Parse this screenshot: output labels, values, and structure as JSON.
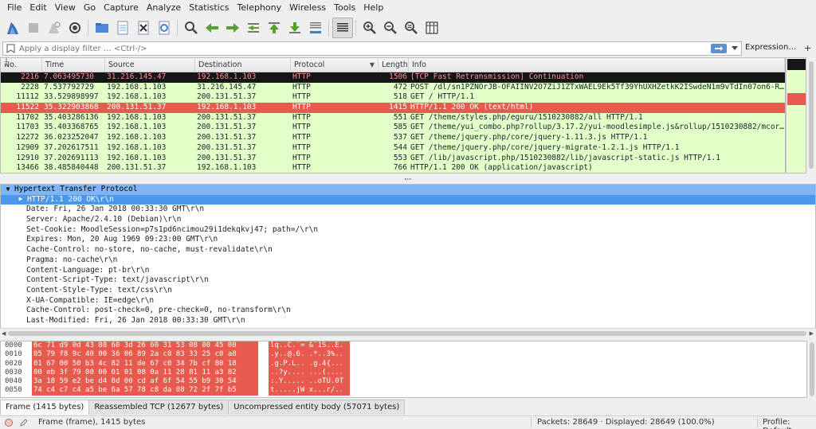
{
  "menu": [
    "File",
    "Edit",
    "View",
    "Go",
    "Capture",
    "Analyze",
    "Statistics",
    "Telephony",
    "Wireless",
    "Tools",
    "Help"
  ],
  "toolbar_icons": [
    "shark-fin-icon",
    "stop-icon",
    "restart-icon",
    "options-gear-icon",
    "open-folder-icon",
    "save-file-icon",
    "close-file-icon",
    "reload-icon",
    "find-icon",
    "back-arrow-icon",
    "forward-arrow-icon",
    "go-to-packet-icon",
    "first-packet-icon",
    "last-packet-icon",
    "auto-scroll-icon",
    "colorize-icon",
    "zoom-in-icon",
    "zoom-out-icon",
    "zoom-normal-icon",
    "resize-columns-icon"
  ],
  "filter": {
    "placeholder": "Apply a display filter … <Ctrl-/>",
    "expression_label": "Expression…",
    "plus_label": "+"
  },
  "packet_list": {
    "columns": [
      "No.",
      "Time",
      "Source",
      "Destination",
      "Protocol",
      "Length",
      "Info"
    ],
    "rows": [
      {
        "no": "2216",
        "time": "7.063495730",
        "src": "31.216.145.47",
        "dst": "192.168.1.103",
        "proto": "HTTP",
        "len": "1506",
        "info": "[TCP Fast Retransmission] Continuation",
        "style": "black",
        "marker": ""
      },
      {
        "no": "2228",
        "time": "7.537792729",
        "src": "192.168.1.103",
        "dst": "31.216.145.47",
        "proto": "HTTP",
        "len": "472",
        "info": "POST /dl/sn1PZNOrJB-OFAIINV2O7ZiJ1ZTxWAEL9Ek5Tf39YhUXHZetkK2ISwdeN1m9vTdIn07on6-R…",
        "style": "green",
        "marker": ""
      },
      {
        "no": "11112",
        "time": "33.529898997",
        "src": "192.168.1.103",
        "dst": "200.131.51.37",
        "proto": "HTTP",
        "len": "518",
        "info": "GET / HTTP/1.1",
        "style": "green",
        "marker": "┼"
      },
      {
        "no": "11522",
        "time": "35.322903868",
        "src": "200.131.51.37",
        "dst": "192.168.1.103",
        "proto": "HTTP",
        "len": "1415",
        "info": "HTTP/1.1 200 OK  (text/html)",
        "style": "red",
        "marker": "←"
      },
      {
        "no": "11702",
        "time": "35.403286136",
        "src": "192.168.1.103",
        "dst": "200.131.51.37",
        "proto": "HTTP",
        "len": "551",
        "info": "GET /theme/styles.php/eguru/1510230882/all HTTP/1.1",
        "style": "green",
        "marker": "│"
      },
      {
        "no": "11703",
        "time": "35.403368765",
        "src": "192.168.1.103",
        "dst": "200.131.51.37",
        "proto": "HTTP",
        "len": "585",
        "info": "GET /theme/yui_combo.php?rollup/3.17.2/yui-moodlesimple.js&rollup/1510230882/mcor…",
        "style": "green",
        "marker": "│"
      },
      {
        "no": "12272",
        "time": "36.023252047",
        "src": "192.168.1.103",
        "dst": "200.131.51.37",
        "proto": "HTTP",
        "len": "537",
        "info": "GET /theme/jquery.php/core/jquery-1.11.3.js HTTP/1.1",
        "style": "green",
        "marker": "│"
      },
      {
        "no": "12909",
        "time": "37.202617511",
        "src": "192.168.1.103",
        "dst": "200.131.51.37",
        "proto": "HTTP",
        "len": "544",
        "info": "GET /theme/jquery.php/core/jquery-migrate-1.2.1.js HTTP/1.1",
        "style": "green",
        "marker": "│"
      },
      {
        "no": "12910",
        "time": "37.202691113",
        "src": "192.168.1.103",
        "dst": "200.131.51.37",
        "proto": "HTTP",
        "len": "553",
        "info": "GET /lib/javascript.php/1510230882/lib/javascript-static.js HTTP/1.1",
        "style": "green",
        "marker": "│"
      },
      {
        "no": "13466",
        "time": "38.485840448",
        "src": "200.131.51.37",
        "dst": "192.168.1.103",
        "proto": "HTTP",
        "len": "766",
        "info": "HTTP/1.1 200 OK  (application/javascript)",
        "style": "green",
        "marker": "│"
      }
    ]
  },
  "details": [
    {
      "text": "Hypertext Transfer Protocol",
      "indent": 0,
      "tri": "▼",
      "style": "sel"
    },
    {
      "text": "HTTP/1.1 200 OK\\r\\n",
      "indent": 1,
      "tri": "▶",
      "style": "sel2"
    },
    {
      "text": "Date: Fri, 26 Jan 2018 00:33:30 GMT\\r\\n",
      "indent": 2,
      "tri": "",
      "style": ""
    },
    {
      "text": "Server: Apache/2.4.10 (Debian)\\r\\n",
      "indent": 2,
      "tri": "",
      "style": ""
    },
    {
      "text": "Set-Cookie: MoodleSession=p7s1pd6ncimou29i1dekqkvj47; path=/\\r\\n",
      "indent": 2,
      "tri": "",
      "style": ""
    },
    {
      "text": "Expires: Mon, 20 Aug 1969 09:23:00 GMT\\r\\n",
      "indent": 2,
      "tri": "",
      "style": ""
    },
    {
      "text": "Cache-Control: no-store, no-cache, must-revalidate\\r\\n",
      "indent": 2,
      "tri": "",
      "style": ""
    },
    {
      "text": "Pragma: no-cache\\r\\n",
      "indent": 2,
      "tri": "",
      "style": ""
    },
    {
      "text": "Content-Language: pt-br\\r\\n",
      "indent": 2,
      "tri": "",
      "style": ""
    },
    {
      "text": "Content-Script-Type: text/javascript\\r\\n",
      "indent": 2,
      "tri": "",
      "style": ""
    },
    {
      "text": "Content-Style-Type: text/css\\r\\n",
      "indent": 2,
      "tri": "",
      "style": ""
    },
    {
      "text": "X-UA-Compatible: IE=edge\\r\\n",
      "indent": 2,
      "tri": "",
      "style": ""
    },
    {
      "text": "Cache-Control: post-check=0, pre-check=0, no-transform\\r\\n",
      "indent": 2,
      "tri": "",
      "style": ""
    },
    {
      "text": "Last-Modified: Fri, 26 Jan 2018 00:33:30 GMT\\r\\n",
      "indent": 2,
      "tri": "",
      "style": ""
    }
  ],
  "bytes": [
    {
      "off": "0000",
      "hex": "6c 71 d9 0d 43 88 60 3d  26 60 31 53 08 00 45 00",
      "ascii": "lq..C.`= &`1S..E."
    },
    {
      "off": "0010",
      "hex": "05 79 f8 9c 40 00 36 06  89 2a c8 83 33 25 c0 a8",
      "ascii": ".y..@.6. .*..3%.."
    },
    {
      "off": "0020",
      "hex": "01 67 00 50 b3 4c 82 11  de 67 c0 34 7b cf 80 18",
      "ascii": ".g.P.L.. .g.4{..."
    },
    {
      "off": "0030",
      "hex": "00 eb 3f 79 00 00 01 01  08 0a 11 28 81 11 a3 82",
      "ascii": "..?y.... ...(...."
    },
    {
      "off": "0040",
      "hex": "3a 18 59 e2 be d4 8d 00  cd af 6f 54 55 b9 30 54",
      "ascii": ":.Y..... ..oTU.0T"
    },
    {
      "off": "0050",
      "hex": "74 c4 c7 c4 a5 be 6a 57  78 c8 da 08 72 2f 7f b5",
      "ascii": "t.....jW x...r/.."
    }
  ],
  "byte_tabs": [
    "Frame (1415 bytes)",
    "Reassembled TCP (12677 bytes)",
    "Uncompressed entity body (57071 bytes)"
  ],
  "status": {
    "frame": "Frame (frame), 1415 bytes",
    "packets": "Packets: 28649 · Displayed: 28649 (100.0%)",
    "profile": "Profile: Default"
  },
  "colors": {
    "green_row": "#e4ffc7",
    "red_row": "#e85a4e",
    "black_row": "#161616",
    "selected_tree": "#7fb5f4"
  }
}
